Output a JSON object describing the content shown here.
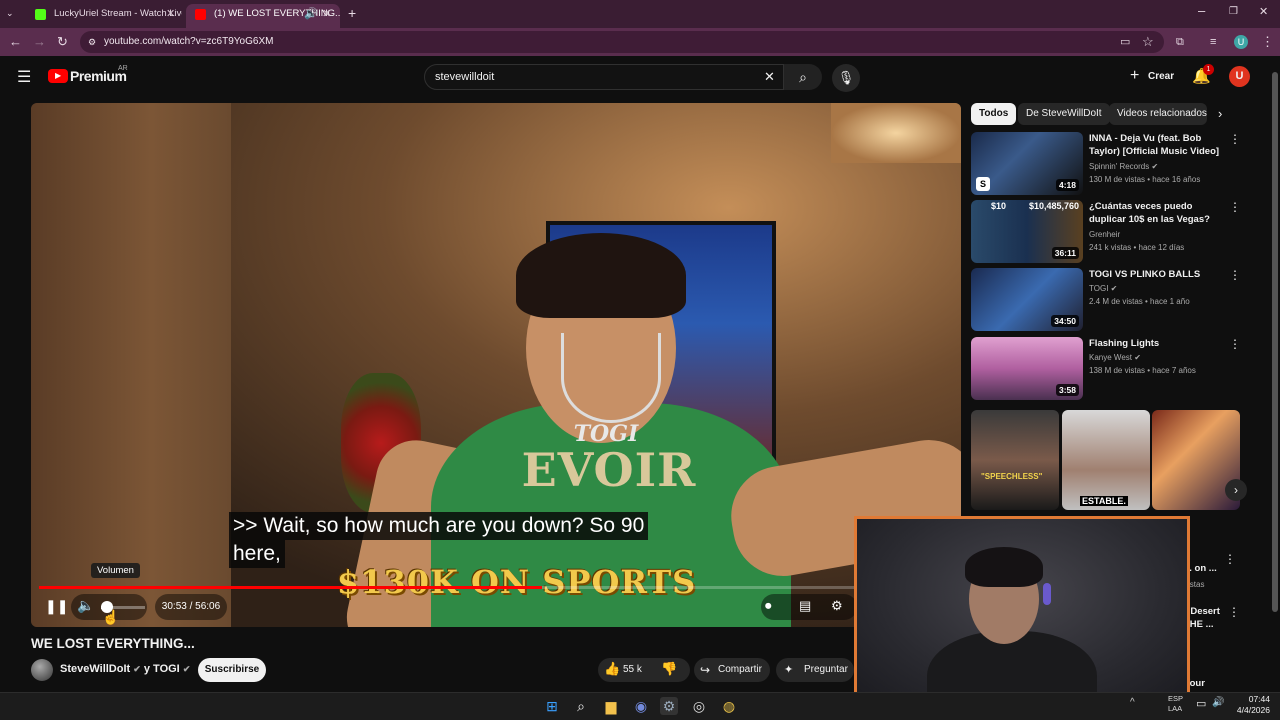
{
  "browser": {
    "tabs": [
      {
        "title": "LuckyUriel Stream - Watch Live"
      },
      {
        "title": "(1) WE LOST EVERYTHING..."
      }
    ],
    "new_tab": "+",
    "url": "youtube.com/watch?v=zc6T9YoG6XM",
    "profile_initial": "U"
  },
  "youtube": {
    "logo_text": "Premium",
    "logo_region": "AR",
    "search_value": "stevewilldoit",
    "create_label": "Crear",
    "notif_count": "1",
    "avatar_initial": "U"
  },
  "player": {
    "caption_line1": ">> Wait, so how much are you down? So 90",
    "caption_line2": "here,",
    "overlay_text": "$130K ON SPORTS",
    "shirt_text": "EVOIR",
    "shirt_logo": "TOGI",
    "time": "30:53 / 56:06",
    "progress_fraction": 0.55,
    "volume_fraction": 0.1,
    "tooltip": "Volumen"
  },
  "video": {
    "title": "WE LOST EVERYTHING...",
    "channel": "SteveWillDoIt",
    "channel_joiner": "y TOGI",
    "subscribe_label": "Suscribirse",
    "likes": "55 k",
    "share_label": "Compartir",
    "ask_label": "Preguntar"
  },
  "sidebar": {
    "chips": [
      "Todos",
      "De SteveWillDoIt",
      "Videos relacionados"
    ],
    "items": [
      {
        "title": "INNA - Deja Vu (feat. Bob Taylor) [Official Music Video]",
        "channel": "Spinnin' Records",
        "meta": "130 M de vistas • hace 16 años",
        "duration": "4:18"
      },
      {
        "title": "¿Cuántas veces puedo duplicar 10$ en las Vegas?",
        "channel": "Grenheir",
        "meta": "241 k vistas • hace 12 días",
        "duration": "36:11"
      },
      {
        "title": "TOGI VS PLINKO BALLS",
        "channel": "TOGI",
        "meta": "2.4 M de vistas • hace 1 año",
        "duration": "34:50"
      },
      {
        "title": "Flashing Lights",
        "channel": "Kanye West",
        "meta": "138 M de vistas • hace 7 años",
        "duration": "3:58"
      }
    ],
    "shorts": [
      {
        "label": "\"SPEECHLESS\""
      },
      {
        "label": "ESTABLE."
      }
    ],
    "partial_items": [
      {
        "title": "... on ...",
        "meta": "vistas"
      },
      {
        "title": "r Desert THE ...",
        "meta": ""
      },
      {
        "title": "Your",
        "meta": ""
      }
    ]
  },
  "thumb_labels": {
    "t2_left": "$10",
    "t2_right": "$10,485,760"
  },
  "taskbar": {
    "lang": "ESP LAA",
    "time": "07:44",
    "date": "4/4/2026"
  },
  "colors": {
    "accent_red": "#ff0000",
    "chrome_bg": "#5a2d4e",
    "webcam_border": "#e07a35"
  }
}
